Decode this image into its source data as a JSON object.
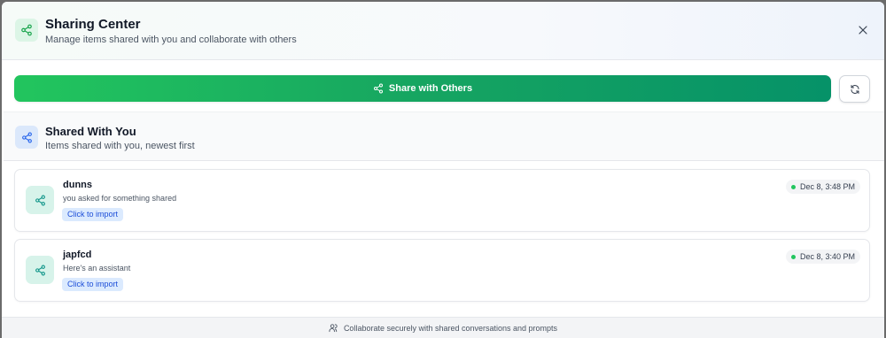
{
  "header": {
    "title": "Sharing Center",
    "subtitle": "Manage items shared with you and collaborate with others",
    "icon": "share-icon",
    "close_icon": "close-icon"
  },
  "toolbar": {
    "share_label": "Share with Others",
    "refresh_icon": "refresh-icon"
  },
  "section": {
    "title": "Shared With You",
    "subtitle": "Items shared with you, newest first"
  },
  "items": [
    {
      "name": "dunns",
      "description": "you asked for something shared",
      "action_label": "Click to import",
      "timestamp": "Dec 8, 3:48 PM"
    },
    {
      "name": "japfcd",
      "description": "Here's an assistant",
      "action_label": "Click to import",
      "timestamp": "Dec 8, 3:40 PM"
    }
  ],
  "footer": {
    "text": "Collaborate securely with shared conversations and prompts"
  },
  "colors": {
    "accent_green": "#22c55e",
    "accent_dark_green": "#069268",
    "import_blue": "#1d4ed8"
  }
}
